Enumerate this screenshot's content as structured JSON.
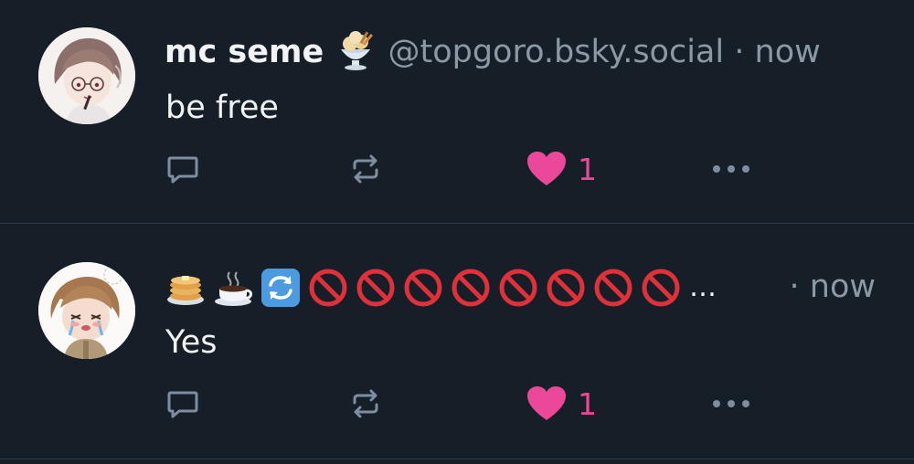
{
  "posts": [
    {
      "display_name": "mc seme",
      "name_emoji": "ice-cream-sundae",
      "handle": "@topgoro.bsky.social",
      "separator": "·",
      "time": "now",
      "text": "be free",
      "like_count": "1",
      "liked": true
    },
    {
      "display_name_emojis": [
        "pancakes",
        "hot-beverage",
        "counterclockwise-arrows",
        "prohibited",
        "prohibited",
        "prohibited",
        "prohibited",
        "prohibited",
        "prohibited",
        "prohibited",
        "prohibited"
      ],
      "truncation": "…",
      "separator": "·",
      "time": "now",
      "text": "Yes",
      "like_count": "1",
      "liked": true
    }
  ],
  "colors": {
    "background": "#161e27",
    "divider": "#2e3a48",
    "muted_text": "#8b98a6",
    "primary_text": "#f1f3f5",
    "like_accent": "#ec4899",
    "icon": "#7d8ea3"
  },
  "icons": {
    "reply": "speech-bubble-icon",
    "repost": "repost-arrows-icon",
    "like": "heart-icon",
    "more": "ellipsis-icon"
  }
}
